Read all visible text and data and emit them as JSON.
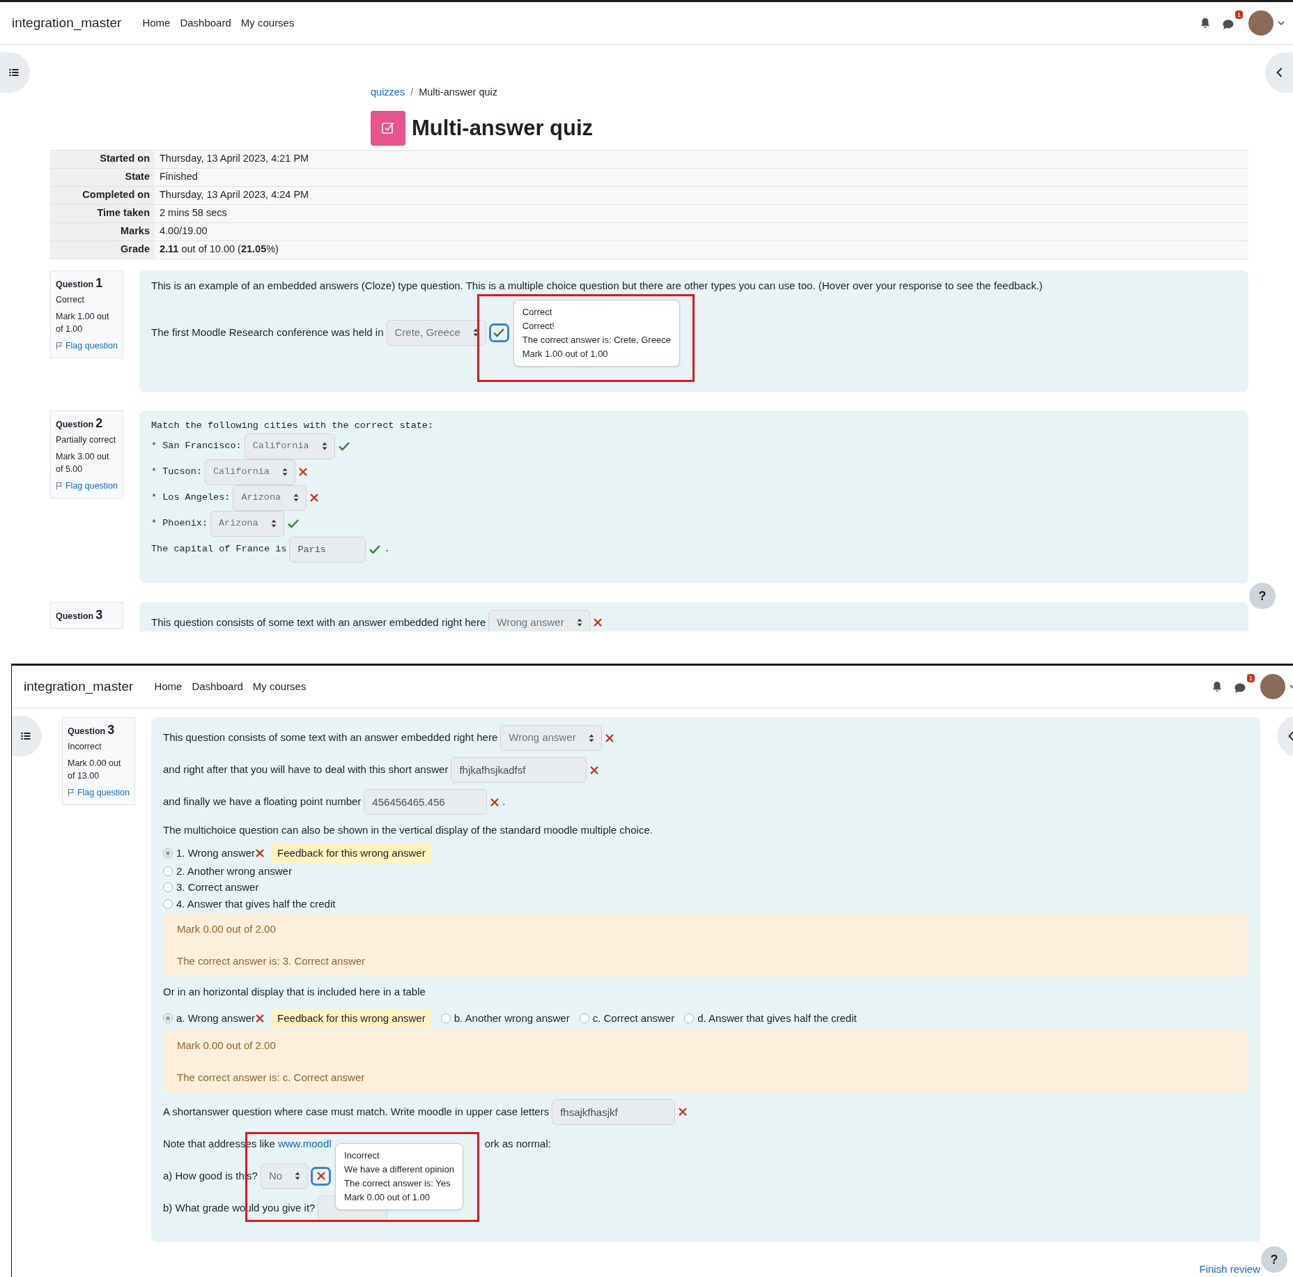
{
  "top_screen": {
    "navbar": {
      "brand": "integration_master",
      "links": [
        "Home",
        "Dashboard",
        "My courses"
      ],
      "message_count": "1"
    },
    "breadcrumb": {
      "separator": "/",
      "items": [
        {
          "text": "quizzes",
          "kind": "link"
        },
        {
          "text": "Multi-answer quiz",
          "kind": "current"
        }
      ]
    },
    "title": "Multi-answer quiz",
    "summary": [
      {
        "label": "Started on",
        "value": "Thursday, 13 April 2023, 4:21 PM"
      },
      {
        "label": "State",
        "value": "Finished"
      },
      {
        "label": "Completed on",
        "value": "Thursday, 13 April 2023, 4:24 PM"
      },
      {
        "label": "Time taken",
        "value": "2 mins 58 secs"
      },
      {
        "label": "Marks",
        "value": "4.00/19.00"
      },
      {
        "label": "Grade",
        "value": "**2.11** out of 10.00 (**21.05**%)"
      }
    ],
    "questions": [
      {
        "info": {
          "label": "Question",
          "number": "1",
          "state": "Correct",
          "mark": "Mark 1.00 out of 1.00",
          "flag": "Flag question"
        },
        "monospace": false,
        "rows": [
          {
            "kind": "paragraph",
            "text": "This is an example of an embedded answers (Cloze) type question. This is a multiple choice question but there are other types you can use too. (Hover over your response to see the feedback.)"
          },
          {
            "kind": "inline",
            "parts": [
              {
                "kind": "text",
                "text": "The first Moodle Research conference was held in"
              },
              {
                "kind": "select",
                "value": "Crete, Greece"
              },
              {
                "kind": "mark",
                "correct": true,
                "focused": true,
                "tooltip": {
                  "highlighted": true,
                  "lines": [
                    "Correct",
                    "Correct!",
                    "The correct answer is: Crete, Greece",
                    "Mark 1.00 out of 1.00"
                  ]
                }
              }
            ]
          }
        ]
      },
      {
        "info": {
          "label": "Question",
          "number": "2",
          "state": "Partially correct",
          "mark": "Mark 3.00 out of 5.00",
          "flag": "Flag question"
        },
        "monospace": true,
        "rows": [
          {
            "kind": "paragraph",
            "text": "Match the following cities with the correct state:"
          },
          {
            "kind": "inline",
            "parts": [
              {
                "kind": "text",
                "text": "* San Francisco:"
              },
              {
                "kind": "select",
                "value": "California"
              },
              {
                "kind": "mark",
                "correct": true,
                "focused": false
              }
            ]
          },
          {
            "kind": "inline",
            "parts": [
              {
                "kind": "text",
                "text": "* Tucson:"
              },
              {
                "kind": "select",
                "value": "California"
              },
              {
                "kind": "mark",
                "correct": false,
                "focused": false
              }
            ]
          },
          {
            "kind": "inline",
            "parts": [
              {
                "kind": "text",
                "text": "* Los Angeles:"
              },
              {
                "kind": "select",
                "value": "Arizona"
              },
              {
                "kind": "mark",
                "correct": false,
                "focused": false
              }
            ]
          },
          {
            "kind": "inline",
            "parts": [
              {
                "kind": "text",
                "text": "* Phoenix:"
              },
              {
                "kind": "select",
                "value": "Arizona"
              },
              {
                "kind": "mark",
                "correct": true,
                "focused": false
              }
            ]
          },
          {
            "kind": "inline",
            "parts": [
              {
                "kind": "text",
                "text": "The capital of France is"
              },
              {
                "kind": "input",
                "value": "Paris"
              },
              {
                "kind": "mark",
                "correct": true,
                "focused": false
              },
              {
                "kind": "text",
                "text": "."
              }
            ]
          }
        ]
      },
      {
        "info": {
          "label": "Question",
          "number": "3"
        },
        "monospace": false,
        "rows": [
          {
            "kind": "inline",
            "parts": [
              {
                "kind": "text",
                "text": "This question consists of some text with an answer embedded right here"
              },
              {
                "kind": "select",
                "value": "Wrong answer"
              },
              {
                "kind": "mark",
                "correct": false,
                "focused": false
              }
            ]
          }
        ]
      }
    ],
    "help_label": "?"
  },
  "bottom_screen": {
    "navbar": {
      "brand": "integration_master",
      "links": [
        "Home",
        "Dashboard",
        "My courses"
      ],
      "message_count": "1"
    },
    "questions": [
      {
        "info": {
          "label": "Question",
          "number": "3",
          "state": "Incorrect",
          "mark": "Mark 0.00 out of 13.00",
          "flag": "Flag question"
        },
        "monospace": false,
        "rows": [
          {
            "kind": "inline",
            "parts": [
              {
                "kind": "text",
                "text": "This question consists of some text with an answer embedded right here"
              },
              {
                "kind": "select",
                "value": "Wrong answer"
              },
              {
                "kind": "mark",
                "correct": false,
                "focused": false
              }
            ]
          },
          {
            "kind": "inline",
            "parts": [
              {
                "kind": "text",
                "text": "and right after that you will have to deal with this short answer"
              },
              {
                "kind": "input",
                "value": "fhjkafhsjkadfsf"
              },
              {
                "kind": "mark",
                "correct": false,
                "focused": false
              }
            ]
          },
          {
            "kind": "inline",
            "parts": [
              {
                "kind": "text",
                "text": "and finally we have a floating point number"
              },
              {
                "kind": "input",
                "value": "456456465.456"
              },
              {
                "kind": "mark",
                "correct": false,
                "focused": false
              },
              {
                "kind": "text",
                "text": "."
              }
            ]
          },
          {
            "kind": "paragraph",
            "text": "The multichoice question can also be shown in the vertical display of the standard moodle multiple choice."
          },
          {
            "kind": "radios_vertical",
            "options": [
              {
                "label": "1. Wrong answer",
                "selected": true,
                "correct": false,
                "feedback": "Feedback for this wrong answer"
              },
              {
                "label": "2. Another wrong answer",
                "selected": false
              },
              {
                "label": "3. Correct answer",
                "selected": false
              },
              {
                "label": "4. Answer that gives half the credit",
                "selected": false
              }
            ]
          },
          {
            "kind": "outcome",
            "lines": [
              "Mark 0.00 out of 2.00",
              "The correct answer is: 3. Correct answer"
            ]
          },
          {
            "kind": "paragraph",
            "text": "Or in an horizontal display that is included here in a table"
          },
          {
            "kind": "radios_horizontal",
            "options": [
              {
                "label": "a. Wrong answer",
                "selected": true,
                "correct": false,
                "feedback": "Feedback for this wrong answer"
              },
              {
                "label": "b. Another wrong answer",
                "selected": false
              },
              {
                "label": "c. Correct answer",
                "selected": false
              },
              {
                "label": "d. Answer that gives half the credit",
                "selected": false
              }
            ]
          },
          {
            "kind": "outcome",
            "lines": [
              "Mark 0.00 out of 2.00",
              "The correct answer is: c. Correct answer"
            ]
          },
          {
            "kind": "inline",
            "parts": [
              {
                "kind": "text",
                "text": "A shortanswer question where case must match. Write moodle in upper case letters"
              },
              {
                "kind": "input",
                "value": "fhsajkfhasjkf"
              },
              {
                "kind": "mark",
                "correct": false,
                "focused": false
              }
            ]
          },
          {
            "kind": "inline",
            "parts": [
              {
                "kind": "text",
                "text": "Note that addresses like"
              },
              {
                "kind": "link",
                "text": "www.moodl"
              },
              {
                "kind": "covered"
              },
              {
                "kind": "text",
                "text": "ork as normal:"
              }
            ]
          },
          {
            "kind": "inline",
            "parts": [
              {
                "kind": "text",
                "text": "a) How good is this?"
              },
              {
                "kind": "select",
                "value": "No"
              },
              {
                "kind": "mark",
                "correct": false,
                "focused": true,
                "tooltip": {
                  "highlighted": true,
                  "lines": [
                    "Incorrect",
                    "We have a different opinion",
                    "The correct answer is: Yes",
                    "Mark 0.00 out of 1.00"
                  ]
                }
              }
            ]
          },
          {
            "kind": "inline",
            "parts": [
              {
                "kind": "text",
                "text": "b) What grade would you give it?"
              },
              {
                "kind": "input"
              }
            ]
          }
        ]
      }
    ],
    "finish_link": "Finish review",
    "help_label": "?"
  }
}
